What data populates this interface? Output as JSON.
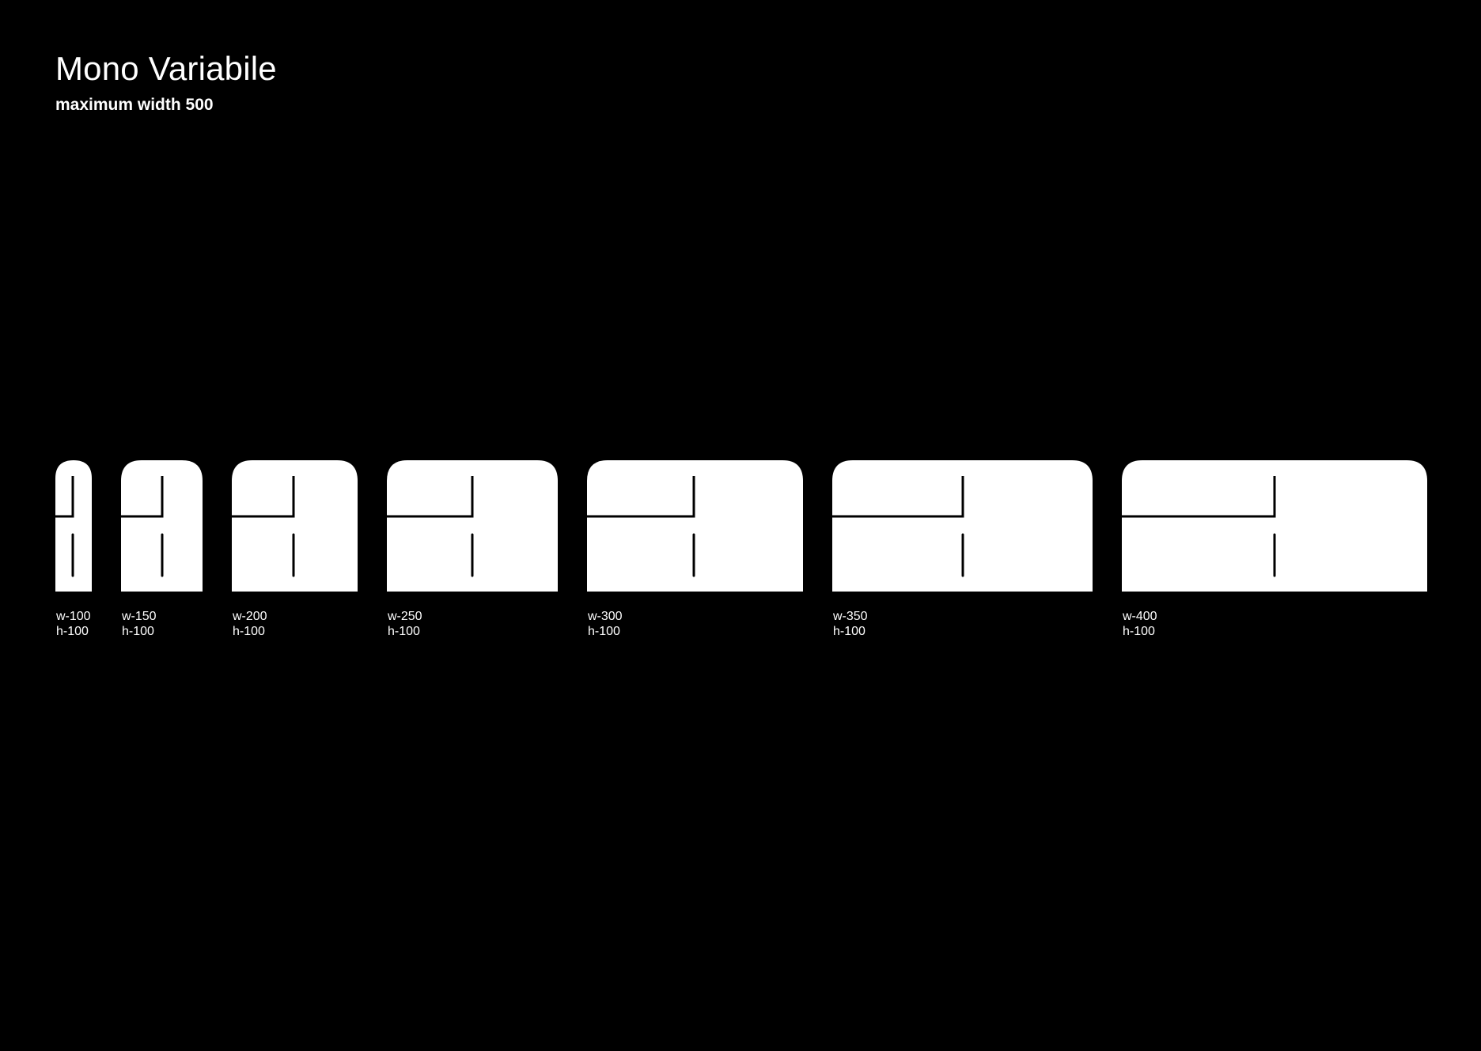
{
  "header": {
    "title": "Mono Variabile",
    "subtitle": "maximum width 500"
  },
  "colors": {
    "background": "#000000",
    "glyph": "#ffffff",
    "stroke": "#000000"
  },
  "variants": [
    {
      "w_label": "w-100",
      "h_label": "h-100",
      "width": 100,
      "height": 100
    },
    {
      "w_label": "w-150",
      "h_label": "h-100",
      "width": 150,
      "height": 100
    },
    {
      "w_label": "w-200",
      "h_label": "h-100",
      "width": 200,
      "height": 100
    },
    {
      "w_label": "w-250",
      "h_label": "h-100",
      "width": 250,
      "height": 100
    },
    {
      "w_label": "w-300",
      "h_label": "h-100",
      "width": 300,
      "height": 100
    },
    {
      "w_label": "w-350",
      "h_label": "h-100",
      "width": 350,
      "height": 100
    },
    {
      "w_label": "w-400",
      "h_label": "h-100",
      "width": 400,
      "height": 100
    }
  ]
}
